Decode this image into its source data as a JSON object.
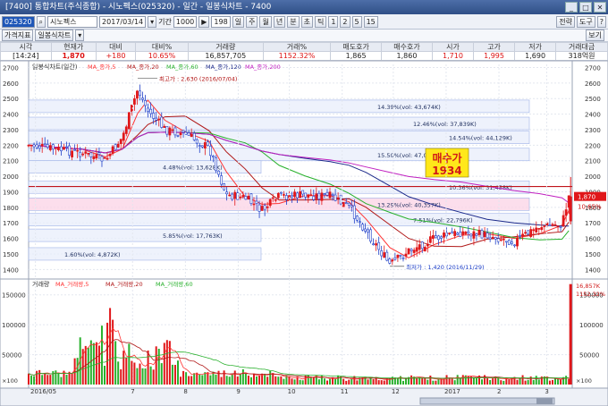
{
  "window": {
    "title": "[7400] 통합차트(주식종합) - 시노펙스(025320) - 일간 - 일봉식차트 - 7400",
    "buttons": [
      "_",
      "□",
      "✕"
    ]
  },
  "toolbar": {
    "code": "025320",
    "name": "시노펙스",
    "date": "2017/03/14",
    "period_label": "기간",
    "period_value": "1000",
    "count": "198",
    "units": [
      "일",
      "주",
      "월",
      "년",
      "분",
      "초",
      "틱",
      "1",
      "2",
      "5",
      "15"
    ],
    "right_buttons": [
      "전략",
      "도구"
    ]
  },
  "toolbar2": {
    "items": [
      "가격지표",
      "일봉식차트"
    ],
    "right_button": "보기"
  },
  "quote": {
    "headers": [
      "시각",
      "현재가",
      "대비",
      "대비%",
      "거래량",
      "거래%",
      "매도호가",
      "매수호가",
      "시가",
      "고가",
      "저가",
      "거래대금"
    ],
    "values": [
      "[14:24]",
      "1,870",
      "+180",
      "10.65%",
      "16,857,705",
      "1152.32%",
      "1,865",
      "1,860",
      "1,710",
      "1,995",
      "1,690",
      "318억원"
    ]
  },
  "chart_data": [
    {
      "type": "candlestick",
      "title": "일봉식차트(일간)",
      "legend": [
        "MA_종가,5",
        "MA_종가,20",
        "MA_종가,60",
        "MA_종가,120",
        "MA_종가,200"
      ],
      "y_ticks": [
        1400,
        1500,
        1600,
        1700,
        1800,
        1900,
        2000,
        2100,
        2200,
        2300,
        2400,
        2500,
        2600,
        2700
      ],
      "ylim": [
        1350,
        2720
      ],
      "x_ticks": [
        "2016/05",
        "7",
        "8",
        "9",
        "10",
        "11",
        "12",
        "2017",
        "2",
        "3"
      ],
      "close_path": [
        [
          "2016/05",
          2200
        ],
        [
          "2016/06/01",
          2150
        ],
        [
          "2016/06/15",
          2100
        ],
        [
          "2016/06/25",
          2250
        ],
        [
          "2016/07/04",
          2560
        ],
        [
          "2016/07/10",
          2420
        ],
        [
          "2016/07/20",
          2300
        ],
        [
          "2016/08/01",
          2270
        ],
        [
          "2016/08/15",
          2180
        ],
        [
          "2016/08/25",
          1880
        ],
        [
          "2016/09/05",
          1860
        ],
        [
          "2016/09/15",
          1780
        ],
        [
          "2016/09/25",
          1870
        ],
        [
          "2016/10/10",
          1880
        ],
        [
          "2016/10/25",
          1870
        ],
        [
          "2016/11/05",
          1800
        ],
        [
          "2016/11/15",
          1650
        ],
        [
          "2016/11/29",
          1430
        ],
        [
          "2016/12/10",
          1520
        ],
        [
          "2016/12/25",
          1600
        ],
        [
          "2017/01/10",
          1640
        ],
        [
          "2017/01/25",
          1620
        ],
        [
          "2017/02/10",
          1580
        ],
        [
          "2017/02/25",
          1680
        ],
        [
          "2017/03/10",
          1690
        ],
        [
          "2017/03/14",
          1870
        ]
      ],
      "annotations": {
        "high": "최고가 : 2,630 (2016/07/04)",
        "low": "최저가 : 1,420 (2016/11/29)",
        "buy_label": "매수가",
        "buy_value": "1934",
        "buy_price": 1934,
        "boxes": [
          {
            "label": "14.39%(vol: 43,674K)",
            "price": 2450
          },
          {
            "label": "12.46%(vol: 37,839K)",
            "price": 2340
          },
          {
            "label": "14.54%(vol: 44,129K)",
            "price": 2250
          },
          {
            "label": "15.50%(vol: 47,064K)",
            "price": 2140
          },
          {
            "label": "4.48%(vol: 13,628K)",
            "price": 2060
          },
          {
            "label": "10.36%(vol: 31,458K)",
            "price": 1930
          },
          {
            "label": "13.29%(vol: 40,357K)",
            "price": 1820
          },
          {
            "label": "7.51%(vol: 22,796K)",
            "price": 1720
          },
          {
            "label": "5.85%(vol: 17,763K)",
            "price": 1620
          },
          {
            "label": "1.60%(vol: 4,872K)",
            "price": 1500
          }
        ]
      },
      "right_labels": {
        "current": "1,870",
        "change": "10.65%"
      }
    },
    {
      "type": "bar",
      "title": "거래량",
      "legend": [
        "MA_거래량,5",
        "MA_거래량,20",
        "MA_거래량,60"
      ],
      "y_ticks": [
        "50000",
        "100000",
        "150000"
      ],
      "scale_label": "×100",
      "right_labels": {
        "change": "16,857K",
        "percent": "1152.32%"
      }
    }
  ],
  "colors": {
    "up": "#e0171a",
    "down": "#1f3fc8",
    "ma5": "#ff3333",
    "ma20": "#b01818",
    "ma60": "#28b02c",
    "ma120": "#1c2a8a",
    "ma200": "#c020c0",
    "buy_line": "#c0141b",
    "buy_box": "#ffe81a"
  }
}
